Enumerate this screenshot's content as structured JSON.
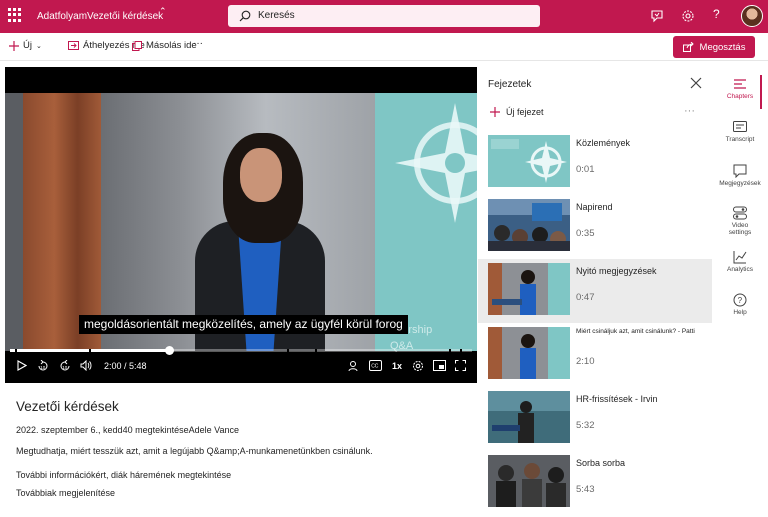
{
  "topbar": {
    "app_name": "Adatfolyam",
    "site_title": "Vezetői kérdések",
    "search_placeholder": "Keresés",
    "brand_color": "#c1184f"
  },
  "commandbar": {
    "new_label": "Új",
    "move_label": "Áthelyezés ide",
    "copy_label": "Másolás ide",
    "more_label": "···",
    "share_label": "Megosztás"
  },
  "player": {
    "caption": "megoldásorientált megközelítés, amely az ügyfél körül forog",
    "overlay_text_1": "adership",
    "overlay_text_2": "Q&A",
    "time": "2:00 / 5:48",
    "progress_fraction": 0.345,
    "speed": "1x",
    "chapter_marks": [
      0.01,
      0.172,
      0.6,
      0.66,
      0.95,
      0.975
    ]
  },
  "video": {
    "title": "Vezetői kérdések",
    "meta": "2022. szeptember 6., kedd40 megtekintéseAdele Vance",
    "description": "Megtudhatja, miért tesszük azt, amit a legújabb Q&amp;A-munkamenetünkben csinálunk.",
    "more_info": "További információkért, diák háremének megtekintése",
    "show_more": "Továbbiak megjelenítése"
  },
  "chapters": {
    "header": "Fejezetek",
    "new_chapter": "Új fejezet",
    "more": "···",
    "items": [
      {
        "name": "Közlemények",
        "time": "0:01",
        "active": false
      },
      {
        "name": "Napirend",
        "time": "0:35",
        "active": false
      },
      {
        "name": "Nyitó megjegyzések",
        "time": "0:47",
        "active": true
      },
      {
        "name": "Miért csináljuk azt, amit csinálunk? - Patti",
        "time": "2:10",
        "active": false
      },
      {
        "name": "HR-frissítések - Irvin",
        "time": "5:32",
        "active": false
      },
      {
        "name": "Sorba sorba",
        "time": "5:43",
        "active": false
      }
    ]
  },
  "rail": {
    "chapters": "Chapters",
    "transcript": "Transcript",
    "notes": "Megjegyzések",
    "video_settings_1": "Video",
    "video_settings_2": "settings",
    "analytics": "Analytics",
    "help": "Help"
  }
}
